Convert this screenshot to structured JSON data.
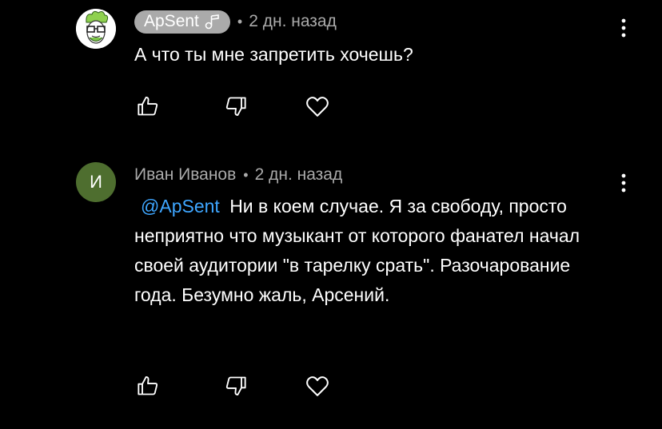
{
  "comments": [
    {
      "author": "ApSent",
      "author_is_creator": true,
      "author_badge_icon": "music-note-icon",
      "separator": "•",
      "time": "2 дн. назад",
      "text": "А что ты мне запретить хочешь?",
      "mention": "",
      "avatar_icon": "cartoon-face-avatar"
    },
    {
      "author": "Иван Иванов",
      "author_is_creator": false,
      "separator": "•",
      "time": "2 дн. назад",
      "avatar_letter": "И",
      "mention": "@ApSent",
      "text": "Ни в коем случае. Я за свободу, просто неприятно что музыкант от которого фанател начал своей аудитории \"в тарелку срать\". Разочарование года. Безумно жаль, Арсений."
    }
  ],
  "icons": {
    "like": "thumbs-up-icon",
    "dislike": "thumbs-down-icon",
    "heart": "heart-icon",
    "menu": "more-vertical-icon"
  },
  "colors": {
    "background": "#000000",
    "meta_text": "#aaaaaa",
    "mention": "#3ea6ff",
    "avatar_bg": "#4e6e2f",
    "badge_bg": "#aaaaaa"
  }
}
